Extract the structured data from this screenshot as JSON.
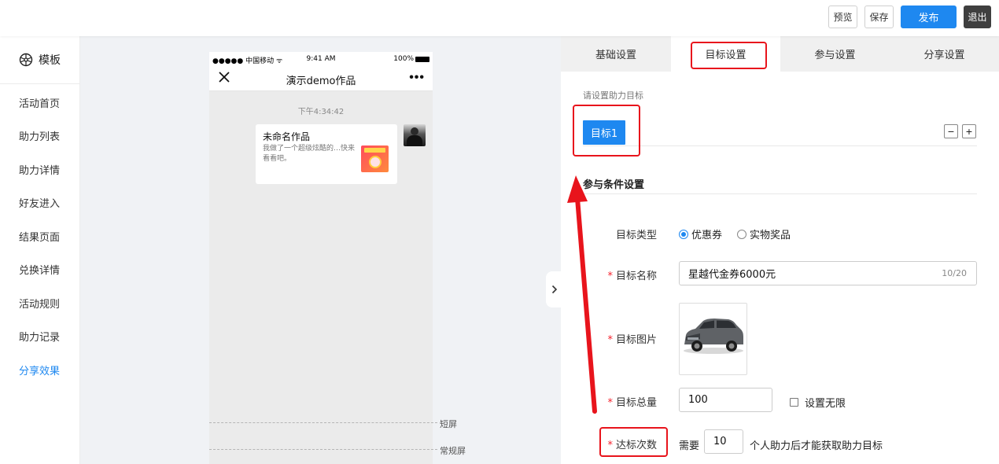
{
  "toolbar": {
    "preview_label": "预览",
    "save_label": "保存",
    "publish_label": "发布",
    "exit_label": "退出"
  },
  "sidebar": {
    "template_label": "模板",
    "items": [
      {
        "label": "活动首页"
      },
      {
        "label": "助力列表"
      },
      {
        "label": "助力详情"
      },
      {
        "label": "好友进入"
      },
      {
        "label": "结果页面"
      },
      {
        "label": "兑换详情"
      },
      {
        "label": "活动规则"
      },
      {
        "label": "助力记录"
      },
      {
        "label": "分享效果",
        "active": true
      }
    ]
  },
  "phone": {
    "status_left": "●●●●● 中国移动 ᯤ",
    "status_time": "9:41 AM",
    "status_battery": "100%",
    "title": "演示demo作品",
    "chat_time": "下午4:34:42",
    "card_title": "未命名作品",
    "card_desc": "我做了一个超级炫酷的…快来看看吧。",
    "short_screen_label": "短屏",
    "normal_screen_label": "常规屏"
  },
  "tabs": [
    {
      "label": "基础设置"
    },
    {
      "label": "目标设置",
      "active": true
    },
    {
      "label": "参与设置"
    },
    {
      "label": "分享设置"
    }
  ],
  "goal": {
    "hint": "请设置助力目标",
    "tab_label": "目标1",
    "remove_symbol": "−",
    "add_symbol": "+"
  },
  "conditions": {
    "section_title": "参与条件设置",
    "type_label": "目标类型",
    "type_options": [
      {
        "label": "优惠券",
        "selected": true
      },
      {
        "label": "实物奖品",
        "selected": false
      }
    ],
    "name_label": "目标名称",
    "name_value": "星越代金券6000元",
    "name_counter": "10/20",
    "image_label": "目标图片",
    "total_label": "目标总量",
    "total_value": "100",
    "unlimited_label": "设置无限",
    "times_label": "达标次数",
    "times_prefix": "需要",
    "times_value": "10",
    "times_suffix": "个人助力后才能获取助力目标"
  },
  "colors": {
    "accent": "#1e88f0",
    "annotation_red": "#e8141c",
    "required": "#f5222d"
  }
}
